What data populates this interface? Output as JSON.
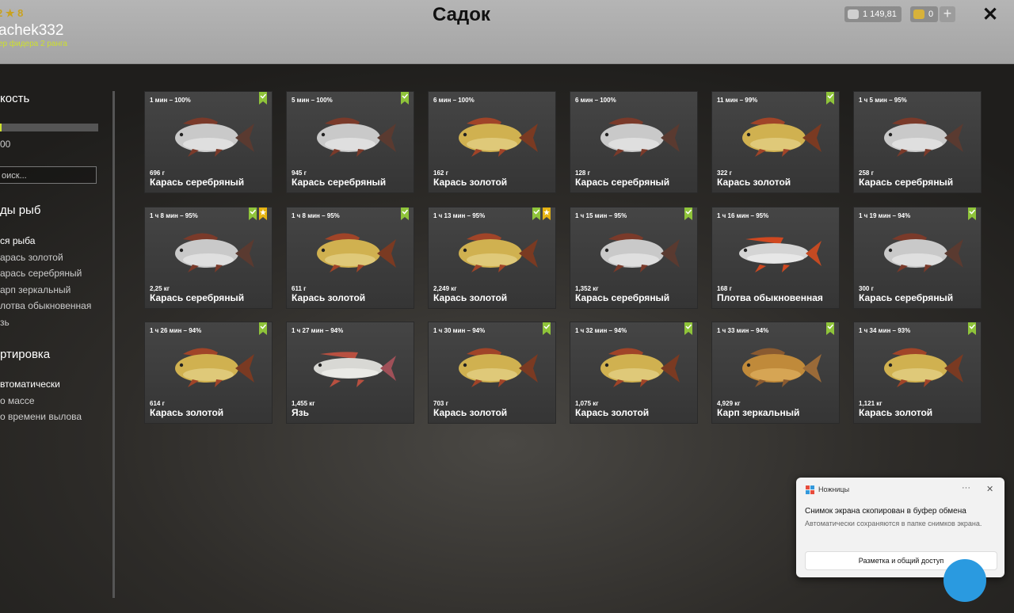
{
  "header": {
    "title": "Садок",
    "rating": "2 ★ 8",
    "username": "achek332",
    "rank": "ер фидера 2 ранга",
    "currency_silver": "1 149,81",
    "currency_gold": "0",
    "plus_label": "+",
    "close_label": "✕"
  },
  "sidebar": {
    "sections": [
      "кость",
      "ды рыб",
      "ртировка"
    ],
    "slider_value": "00",
    "search_placeholder": "оиск...",
    "species": [
      "ся рыба",
      "арась золотой",
      "арась серебряный",
      "арп зеркальный",
      "лотва обыкновенная",
      "зь"
    ],
    "sort": [
      "втоматически",
      "о массе",
      "о времени вылова"
    ]
  },
  "cards": [
    {
      "time": "1 мин – 100%",
      "weight": "696 г",
      "name": "Карась серебряный",
      "badges": [
        "check"
      ],
      "color": "silver"
    },
    {
      "time": "5 мин – 100%",
      "weight": "945 г",
      "name": "Карась серебряный",
      "badges": [
        "check"
      ],
      "color": "silver"
    },
    {
      "time": "6 мин – 100%",
      "weight": "162 г",
      "name": "Карась золотой",
      "badges": [],
      "color": "gold"
    },
    {
      "time": "6 мин – 100%",
      "weight": "128 г",
      "name": "Карась серебряный",
      "badges": [],
      "color": "silver"
    },
    {
      "time": "11 мин – 99%",
      "weight": "322 г",
      "name": "Карась золотой",
      "badges": [
        "check"
      ],
      "color": "gold"
    },
    {
      "time": "1 ч 5 мин – 95%",
      "weight": "258 г",
      "name": "Карась серебряный",
      "badges": [],
      "color": "silver"
    },
    {
      "time": "1 ч 8 мин – 95%",
      "weight": "2,25 кг",
      "name": "Карась серебряный",
      "badges": [
        "check",
        "star"
      ],
      "color": "silver"
    },
    {
      "time": "1 ч 8 мин – 95%",
      "weight": "611 г",
      "name": "Карась золотой",
      "badges": [
        "check"
      ],
      "color": "gold"
    },
    {
      "time": "1 ч 13 мин – 95%",
      "weight": "2,249 кг",
      "name": "Карась золотой",
      "badges": [
        "check",
        "star"
      ],
      "color": "gold"
    },
    {
      "time": "1 ч 15 мин – 95%",
      "weight": "1,352 кг",
      "name": "Карась серебряный",
      "badges": [
        "check"
      ],
      "color": "silver"
    },
    {
      "time": "1 ч 16 мин – 95%",
      "weight": "168 г",
      "name": "Плотва обыкновенная",
      "badges": [],
      "color": "roach"
    },
    {
      "time": "1 ч 19 мин – 94%",
      "weight": "300 г",
      "name": "Карась серебряный",
      "badges": [
        "check"
      ],
      "color": "silver"
    },
    {
      "time": "1 ч 26 мин – 94%",
      "weight": "614 г",
      "name": "Карась золотой",
      "badges": [
        "check"
      ],
      "color": "gold"
    },
    {
      "time": "1 ч 27 мин – 94%",
      "weight": "1,455 кг",
      "name": "Язь",
      "badges": [],
      "color": "ide"
    },
    {
      "time": "1 ч 30 мин – 94%",
      "weight": "703 г",
      "name": "Карась золотой",
      "badges": [
        "check"
      ],
      "color": "gold"
    },
    {
      "time": "1 ч 32 мин – 94%",
      "weight": "1,075 кг",
      "name": "Карась золотой",
      "badges": [
        "check"
      ],
      "color": "gold"
    },
    {
      "time": "1 ч 33 мин – 94%",
      "weight": "4,929 кг",
      "name": "Карп зеркальный",
      "badges": [
        "check"
      ],
      "color": "carp"
    },
    {
      "time": "1 ч 34 мин – 93%",
      "weight": "1,121 кг",
      "name": "Карась золотой",
      "badges": [
        "check"
      ],
      "color": "gold"
    }
  ],
  "toast": {
    "app": "Ножницы",
    "more": "···",
    "close": "✕",
    "message": "Снимок экрана скопирован в буфер обмена",
    "sub": "Автоматически сохраняются в папке снимков экрана.",
    "button": "Разметка и общий доступ"
  },
  "colors": {
    "accent": "#cde02e",
    "badge_check": "#8fc43a",
    "badge_star": "#e5b312"
  }
}
